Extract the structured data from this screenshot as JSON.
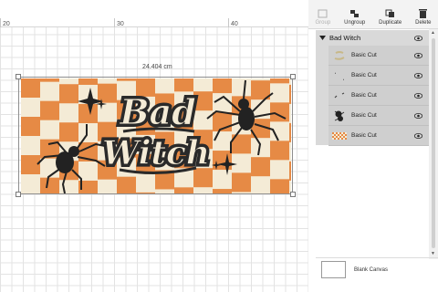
{
  "ruler": {
    "labels": [
      "20",
      "30",
      "40"
    ]
  },
  "canvas": {
    "dimension_label": "24.404 cm",
    "artwork": {
      "title_line1": "Bad",
      "title_line2": "Witch",
      "orange": "#e68a45",
      "cream": "#f4ebd6",
      "dark": "#222222"
    }
  },
  "toolbar": {
    "group_label": "Group",
    "ungroup_label": "Ungroup",
    "duplicate_label": "Duplicate",
    "delete_label": "Delete"
  },
  "layers": {
    "group_name": "Bad Witch",
    "items": [
      {
        "label": "Basic Cut",
        "thumb": "bad-witch-text-thumb"
      },
      {
        "label": "Basic Cut",
        "thumb": "sparkles-thumb"
      },
      {
        "label": "Basic Cut",
        "thumb": "small-stars-thumb"
      },
      {
        "label": "Basic Cut",
        "thumb": "spiders-thumb"
      },
      {
        "label": "Basic Cut",
        "thumb": "checker-thumb"
      }
    ]
  },
  "footer": {
    "blank_canvas_label": "Blank Canvas"
  }
}
